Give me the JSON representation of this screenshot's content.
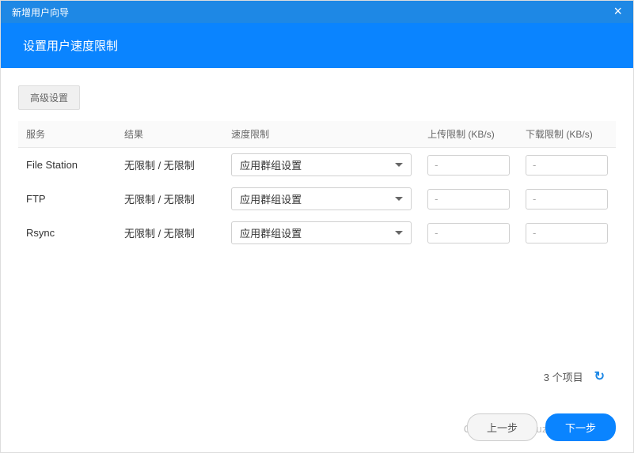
{
  "titlebar": {
    "title": "新增用户向导",
    "close": "×"
  },
  "subhead": "设置用户速度限制",
  "adv_btn": "高级设置",
  "columns": [
    "服务",
    "结果",
    "速度限制",
    "上传限制 (KB/s)",
    "下载限制 (KB/s)"
  ],
  "rows": [
    {
      "service": "File Station",
      "result": "无限制 / 无限制",
      "speed": "应用群组设置",
      "upload": "-",
      "download": "-"
    },
    {
      "service": "FTP",
      "result": "无限制 / 无限制",
      "speed": "应用群组设置",
      "upload": "-",
      "download": "-"
    },
    {
      "service": "Rsync",
      "result": "无限制 / 无限制",
      "speed": "应用群组设置",
      "upload": "-",
      "download": "-"
    }
  ],
  "footer": {
    "count_label": "3 个项目"
  },
  "actions": {
    "prev": "上一步",
    "next": "下一步"
  },
  "watermark": "CSDN @pzzhouziao"
}
